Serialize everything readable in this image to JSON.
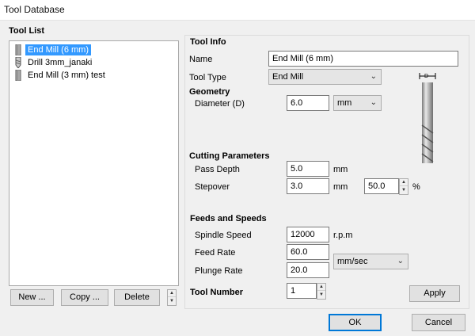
{
  "window": {
    "title": "Tool Database"
  },
  "tool_list": {
    "heading": "Tool List",
    "items": [
      {
        "label": "End Mill (6 mm)",
        "icon": "end-mill-icon",
        "selected": true
      },
      {
        "label": "Drill 3mm_janaki",
        "icon": "drill-icon",
        "selected": false
      },
      {
        "label": "End Mill (3 mm) test",
        "icon": "end-mill-icon",
        "selected": false
      }
    ],
    "buttons": {
      "new": "New ...",
      "copy": "Copy ...",
      "delete": "Delete"
    }
  },
  "tool_info": {
    "heading": "Tool Info",
    "name_label": "Name",
    "name_value": "End Mill (6 mm)",
    "type_label": "Tool Type",
    "type_value": "End Mill",
    "preview_marker": "D"
  },
  "geometry": {
    "heading": "Geometry",
    "diameter_label": "Diameter (D)",
    "diameter_value": "6.0",
    "unit_value": "mm"
  },
  "cutting": {
    "heading": "Cutting Parameters",
    "pass_depth_label": "Pass Depth",
    "pass_depth_value": "5.0",
    "pass_depth_unit": "mm",
    "stepover_label": "Stepover",
    "stepover_value": "3.0",
    "stepover_unit": "mm",
    "stepover_percent_value": "50.0",
    "stepover_percent_unit": "%"
  },
  "feeds": {
    "heading": "Feeds and Speeds",
    "spindle_label": "Spindle Speed",
    "spindle_value": "12000",
    "spindle_unit": "r.p.m",
    "feed_label": "Feed Rate",
    "feed_value": "60.0",
    "plunge_label": "Plunge Rate",
    "plunge_value": "20.0",
    "rate_unit_value": "mm/sec"
  },
  "tool_number": {
    "label": "Tool Number",
    "value": "1"
  },
  "actions": {
    "apply": "Apply",
    "ok": "OK",
    "cancel": "Cancel"
  },
  "colors": {
    "selection": "#3399ff",
    "accent": "#0078d7"
  }
}
